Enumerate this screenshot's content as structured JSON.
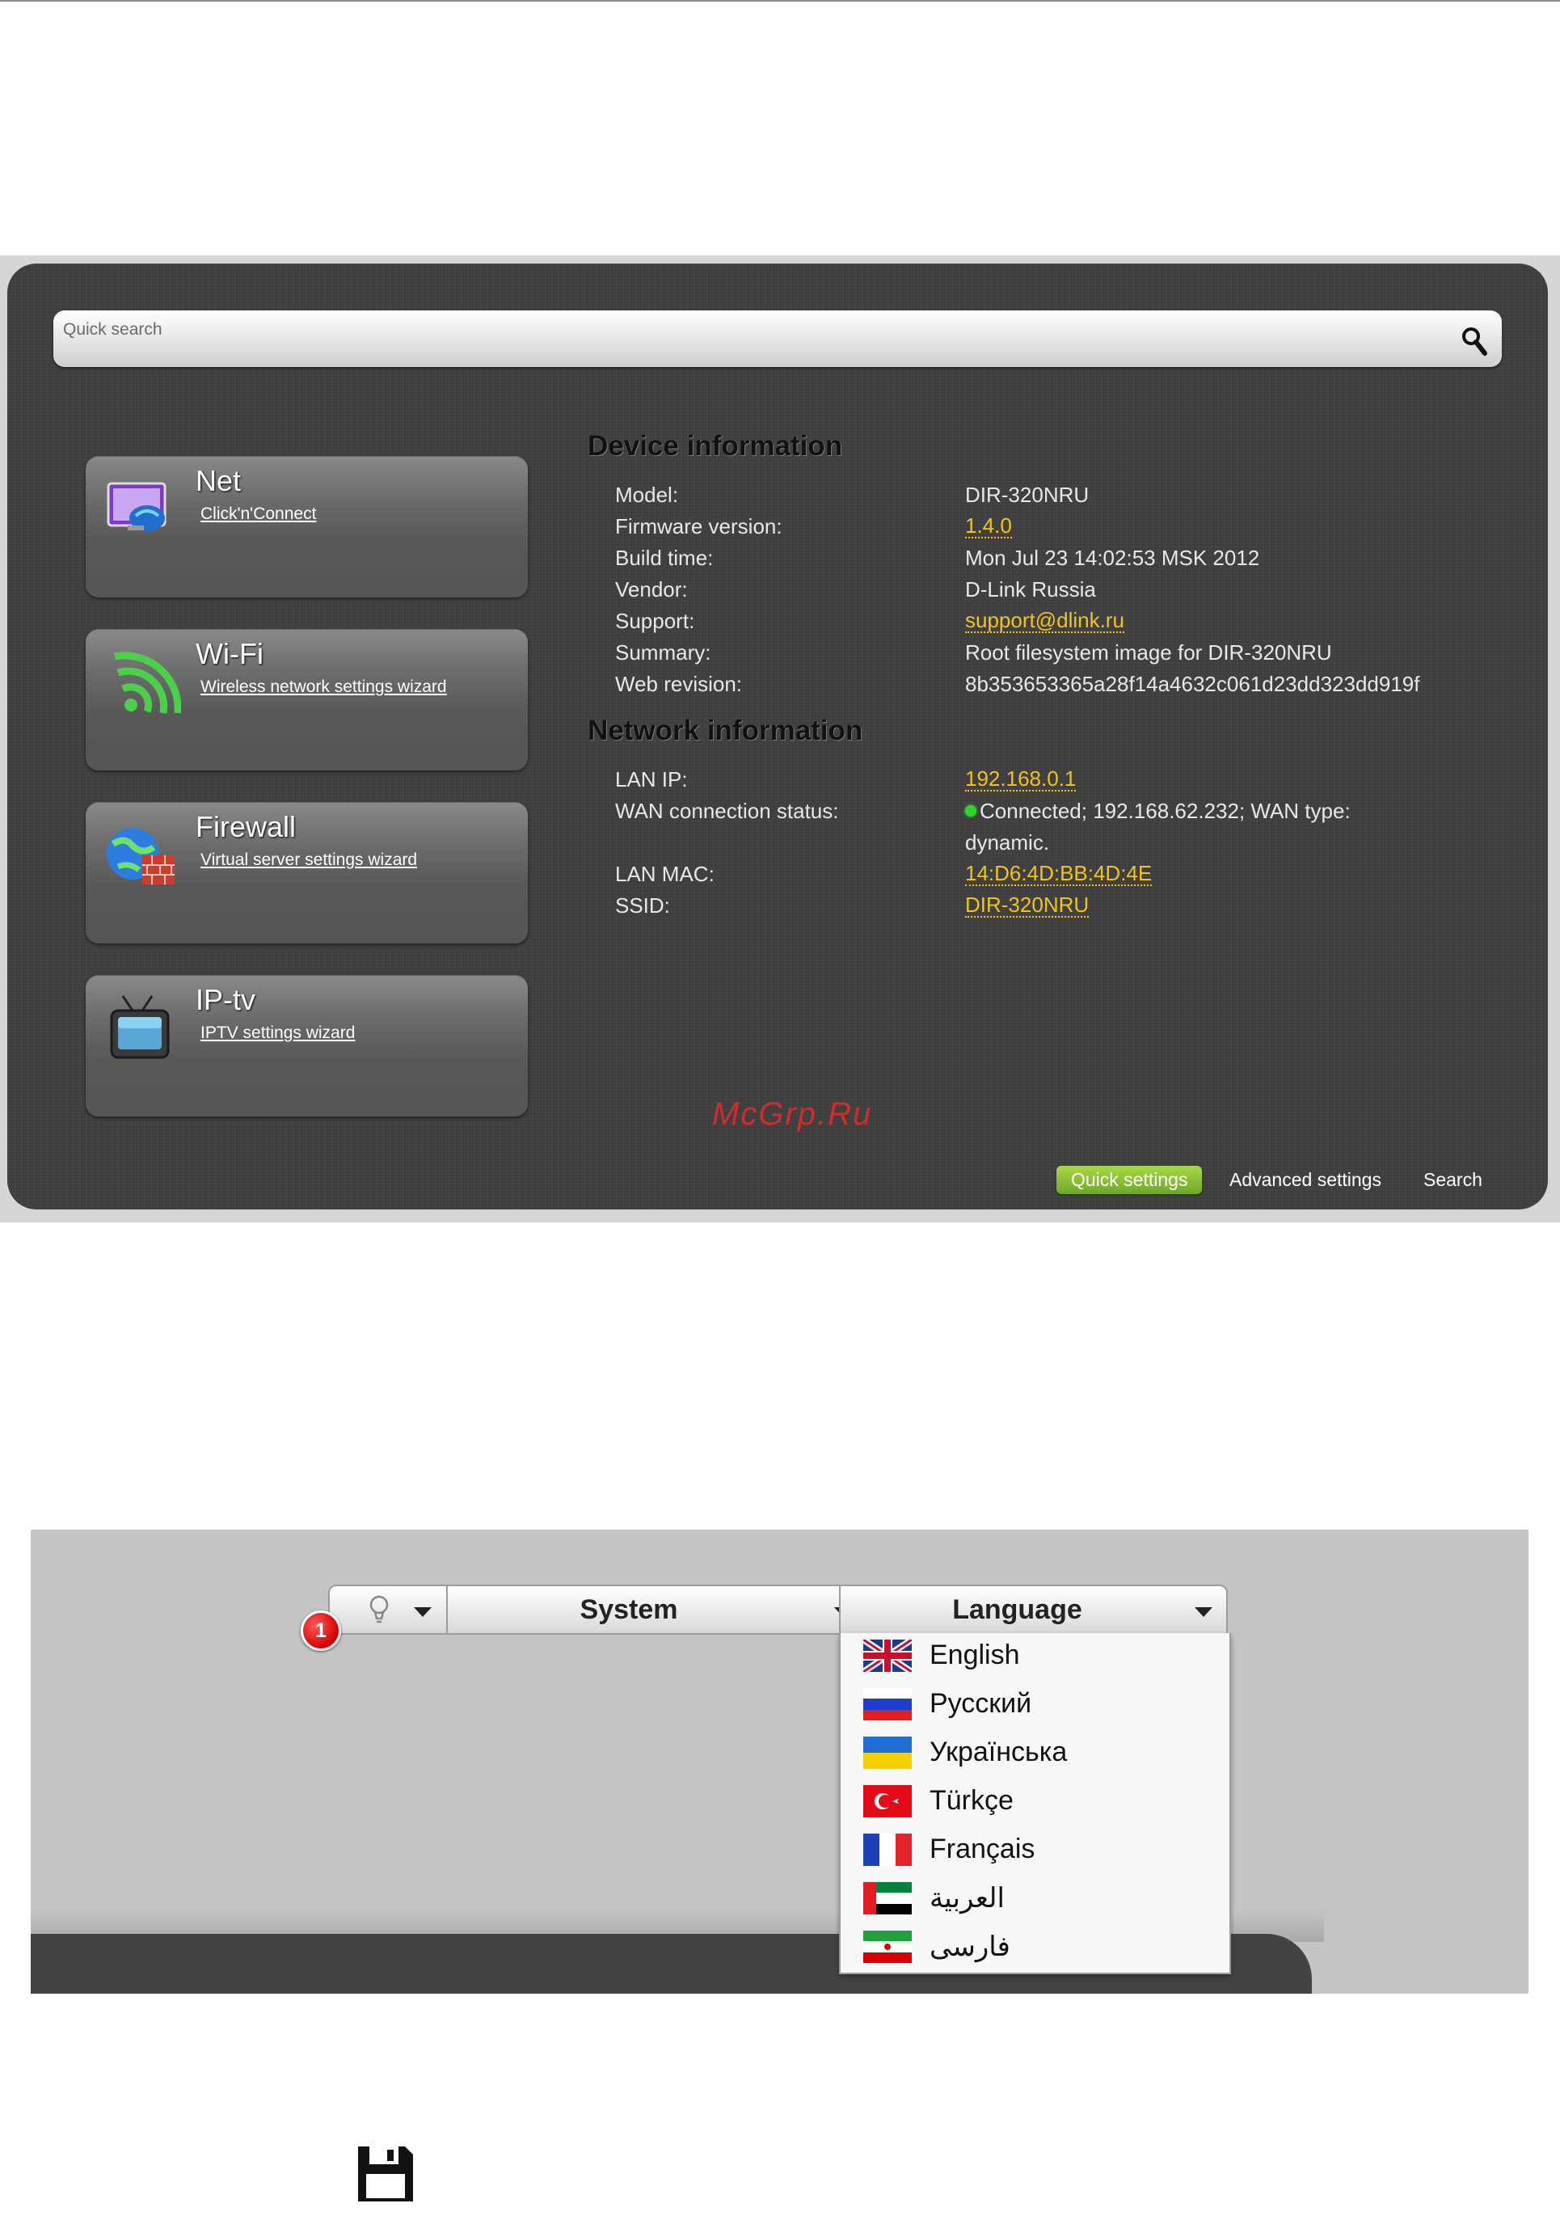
{
  "search": {
    "placeholder": "Quick search"
  },
  "tiles": [
    {
      "title": "Net",
      "link": "Click'n'Connect"
    },
    {
      "title": "Wi-Fi",
      "link": "Wireless network settings wizard"
    },
    {
      "title": "Firewall",
      "link": "Virtual server settings wizard"
    },
    {
      "title": "IP-tv",
      "link": "IPTV settings wizard"
    }
  ],
  "device_info": {
    "title": "Device information",
    "rows": [
      {
        "label": "Model:",
        "value": "DIR-320NRU"
      },
      {
        "label": "Firmware version:",
        "value": "1.4.0"
      },
      {
        "label": "Build time:",
        "value": "Mon Jul 23 14:02:53 MSK 2012"
      },
      {
        "label": "Vendor:",
        "value": "D-Link Russia"
      },
      {
        "label": "Support:",
        "value": "support@dlink.ru"
      },
      {
        "label": "Summary:",
        "value": "Root filesystem image for DIR-320NRU"
      },
      {
        "label": "Web revision:",
        "value": "8b353653365a28f14a4632c061d23dd323dd919f"
      }
    ]
  },
  "network_info": {
    "title": "Network information",
    "rows": [
      {
        "label": "LAN IP:",
        "value": "192.168.0.1"
      },
      {
        "label": "WAN connection status:",
        "value": "Connected; 192.168.62.232; WAN type:",
        "value2": "dynamic."
      },
      {
        "label": "LAN MAC:",
        "value": "14:D6:4D:BB:4D:4E"
      },
      {
        "label": "SSID:",
        "value": "DIR-320NRU"
      }
    ]
  },
  "watermark": "McGrp.Ru",
  "bottom_nav": [
    "Quick settings",
    "Advanced settings",
    "Search"
  ],
  "colors": {
    "accent_link": "#f0c419",
    "active_button": "#8bc63a",
    "status_ok": "#2bd62b",
    "badge": "#d40000"
  },
  "toolbar": {
    "notifications_icon": "lightbulb-icon",
    "system_label": "System",
    "language_label": "Language",
    "badge_number": "1"
  },
  "languages": [
    "English",
    "Русский",
    "Українська",
    "Türkçe",
    "Français",
    "العربية",
    "فارسی"
  ],
  "save_icon": "floppy-disk-icon"
}
